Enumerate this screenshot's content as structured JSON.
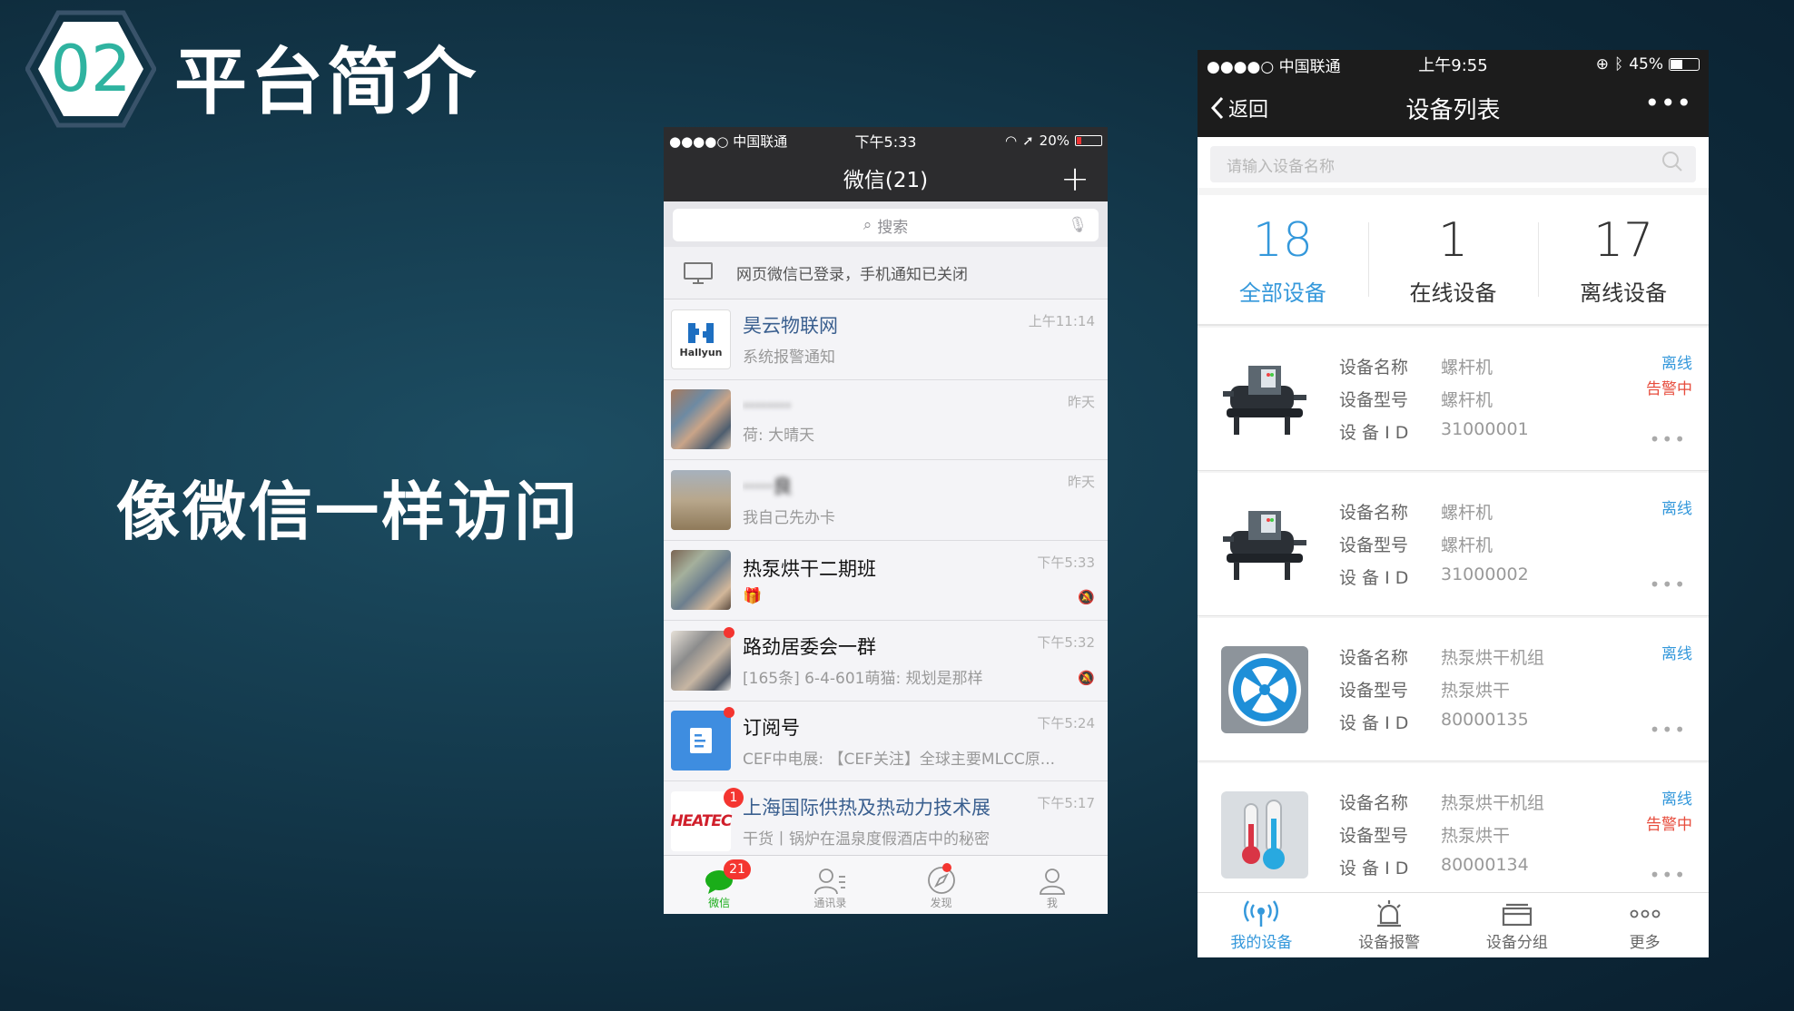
{
  "slide": {
    "number": "02",
    "title": "平台简介",
    "subtitle": "像微信一样访问"
  },
  "wechat": {
    "status": {
      "carrier": "●●●●○ 中国联通",
      "time": "下午5:33",
      "battery": "20%"
    },
    "nav_title": "微信(21)",
    "search_placeholder": "搜索",
    "banner": "网页微信已登录，手机通知已关闭",
    "chats": [
      {
        "name": "昊云物联网",
        "message": "系统报警通知",
        "time": "上午11:14",
        "avatar_text": "Hallyun"
      },
      {
        "name": "········",
        "message": "荷: 大晴天",
        "time": "昨天"
      },
      {
        "name": "·····良",
        "message": "我自己先办卡",
        "time": "昨天"
      },
      {
        "name": "热泵烘干二期班",
        "message": "🎁",
        "time": "下午5:33"
      },
      {
        "name": "路劲居委会一群",
        "message": "[165条] 6-4-601萌猫: 规划是那样",
        "time": "下午5:32"
      },
      {
        "name": "订阅号",
        "message": "CEF中电展: 【CEF关注】全球主要MLCC原...",
        "time": "下午5:24"
      },
      {
        "name": "上海国际供热及热动力技术展",
        "message": "干货丨锅炉在温泉度假酒店中的秘密",
        "time": "下午5:17",
        "avatar_text": "HEATEC",
        "badge": "1"
      }
    ],
    "tabs": [
      {
        "label": "微信",
        "badge": "21"
      },
      {
        "label": "通讯录"
      },
      {
        "label": "发现"
      },
      {
        "label": "我"
      }
    ]
  },
  "devices_app": {
    "status": {
      "carrier": "●●●●○ 中国联通",
      "time": "上午9:55",
      "battery": "45%"
    },
    "back_label": "返回",
    "nav_title": "设备列表",
    "search_placeholder": "请输入设备名称",
    "stats": [
      {
        "value": "18",
        "label": "全部设备"
      },
      {
        "value": "1",
        "label": "在线设备"
      },
      {
        "value": "17",
        "label": "离线设备"
      }
    ],
    "field_labels": {
      "name": "设备名称",
      "model": "设备型号",
      "id": "设 备 I D"
    },
    "devices": [
      {
        "name": "螺杆机",
        "model": "螺杆机",
        "id": "31000001",
        "status": "离线",
        "alarm": "告警中"
      },
      {
        "name": "螺杆机",
        "model": "螺杆机",
        "id": "31000002",
        "status": "离线"
      },
      {
        "name": "热泵烘干机组",
        "model": "热泵烘干",
        "id": "80000135",
        "status": "离线"
      },
      {
        "name": "热泵烘干机组",
        "model": "热泵烘干",
        "id": "80000134",
        "status": "离线",
        "alarm": "告警中"
      }
    ],
    "tabs": [
      {
        "label": "我的设备"
      },
      {
        "label": "设备报警"
      },
      {
        "label": "设备分组"
      },
      {
        "label": "更多"
      }
    ],
    "colors": {
      "accent": "#3498db",
      "alarm": "#e74c3c"
    }
  }
}
